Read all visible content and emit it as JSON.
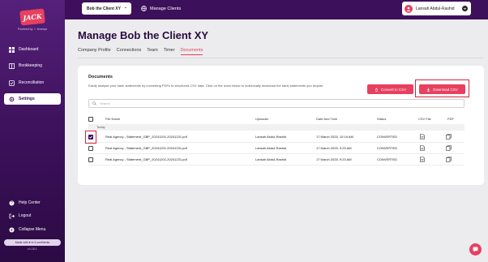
{
  "sidebar": {
    "logo": "JACK",
    "powered_by": "Powered by ✧ Jenesys",
    "items": [
      {
        "label": "Dashboard",
        "icon": "dashboard-icon"
      },
      {
        "label": "Bookkeeping",
        "icon": "book-icon"
      },
      {
        "label": "Reconciliation",
        "icon": "reconcile-icon"
      },
      {
        "label": "Settings",
        "icon": "gear-icon"
      }
    ],
    "footer_items": [
      {
        "label": "Help Center",
        "icon": "help-icon"
      },
      {
        "label": "Logout",
        "icon": "logout-icon"
      },
      {
        "label": "Collapse Menu",
        "icon": "collapse-icon"
      }
    ],
    "made_with": "Made with ♥ in 3 continents",
    "version": "v1.16.1"
  },
  "topbar": {
    "client_select": "Bob the Client XY",
    "manage_clients": "Manage Clients",
    "user_name": "Lansah Abdul-Rashid"
  },
  "page": {
    "title": "Manage Bob the Client XY",
    "tabs": [
      "Company Profile",
      "Connections",
      "Team",
      "Timer",
      "Documents"
    ],
    "active_tab": "Documents"
  },
  "documents": {
    "title": "Documents",
    "description": "Easily analyse your bank statements by converting PDFs to structured CSV data. Click on the icons below to individually download the bank statements you require.",
    "convert_label": "Convert to CSV",
    "download_label": "Download CSV",
    "search_placeholder": "Search",
    "columns": [
      "File Name",
      "Uploader",
      "Date And Time",
      "Status",
      "CSV File",
      "PDF"
    ],
    "group": "Today",
    "rows": [
      {
        "file": "Real Agency - Statement_GBP_20241201-20241231.pdf",
        "uploader": "Lansah Abdul-Rashid",
        "date": "17 March 2025, 10:19 AM",
        "status": "CONVERTED",
        "checked": true
      },
      {
        "file": "Real Agency - Statement_GBP_20241201-20241231.pdf",
        "uploader": "Lansah Abdul-Rashid",
        "date": "17 March 2025, 9:25 AM",
        "status": "CONVERTED",
        "checked": false
      },
      {
        "file": "Real Agency - Statement_GBP_20241201-20241231.pdf",
        "uploader": "Lansah Abdul-Rashid",
        "date": "17 March 2025, 9:23 AM",
        "status": "CONVERTED",
        "checked": false
      }
    ]
  },
  "colors": {
    "brand_purple": "#3c105a",
    "accent_pink": "#e8405f",
    "highlight_red": "#d7263d"
  }
}
